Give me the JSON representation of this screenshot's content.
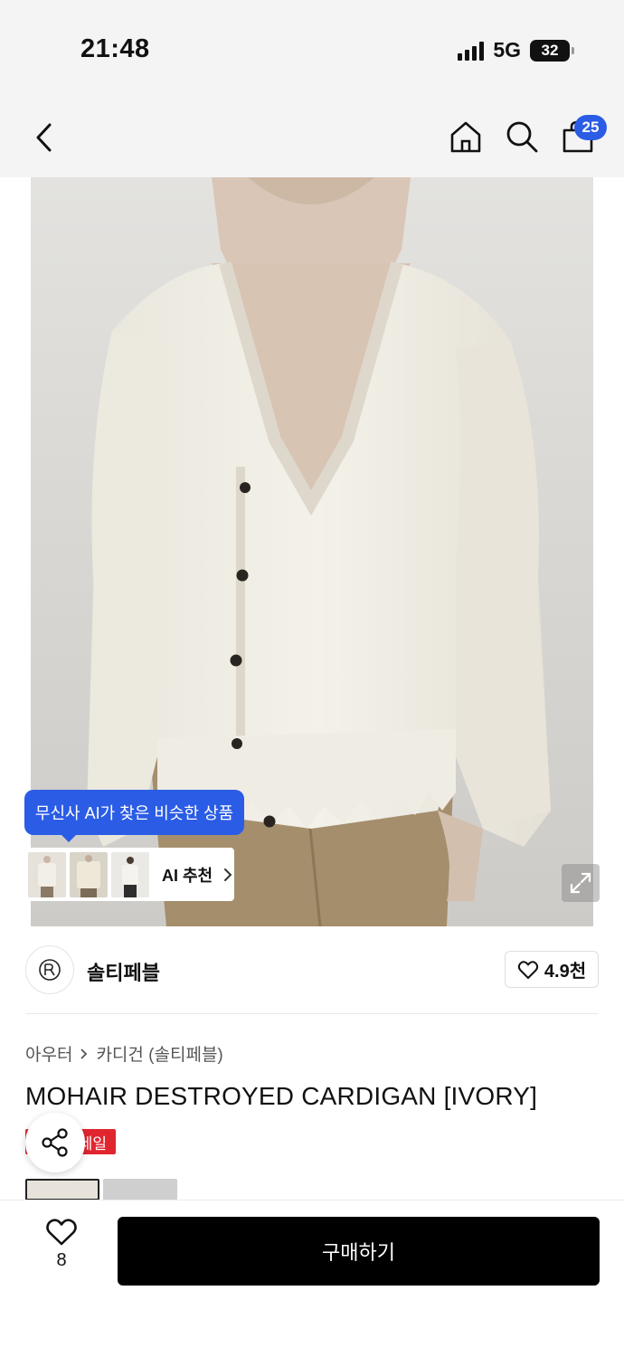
{
  "status_bar": {
    "time": "21:48",
    "network": "5G",
    "battery": "32"
  },
  "header": {
    "cart_count": "25"
  },
  "ai_recommend": {
    "tooltip": "무신사 AI가 찾은 비슷한 상품",
    "label": "AI 추천"
  },
  "brand": {
    "name": "솔티페블",
    "likes": "4.9천"
  },
  "breadcrumb": {
    "category": "아우터",
    "subcategory": "카디건 (솔티페블)"
  },
  "product": {
    "title": "MOHAIR DESTROYED CARDIGAN [IVORY]",
    "badge": "세일"
  },
  "bottom_bar": {
    "wish_count": "8",
    "buy_label": "구매하기"
  },
  "colors": {
    "accent_blue": "#2b5ce6",
    "sale_red": "#e0252f",
    "buy_button": "#000000"
  }
}
